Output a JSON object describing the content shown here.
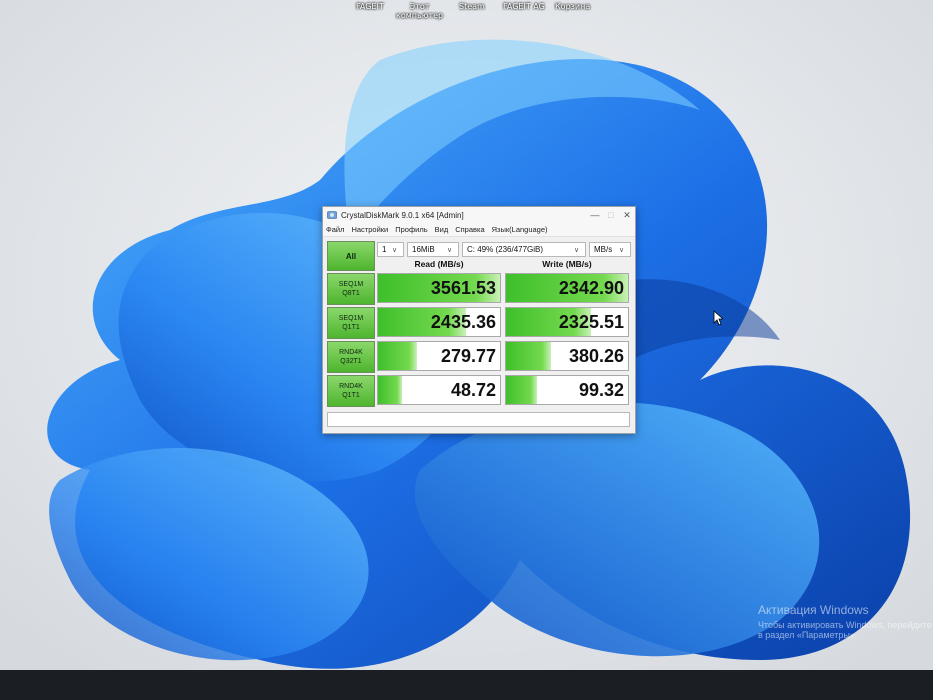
{
  "desktop": {
    "icons": [
      {
        "label": "FAGEIT"
      },
      {
        "label": "Этот\nкомпьютер"
      },
      {
        "label": "Steam"
      },
      {
        "label": "FAGEIT AG"
      },
      {
        "label": "Корзина"
      }
    ],
    "activation": {
      "title": "Активация Windows",
      "subtitle": "Чтобы активировать Windows, перейдите в раздел «Параметры»."
    }
  },
  "window": {
    "title": "CrystalDiskMark 9.0.1 x64 [Admin]",
    "menu": [
      "Файл",
      "Настройки",
      "Профиль",
      "Вид",
      "Справка",
      "Язык(Language)"
    ],
    "all_button": "All",
    "count": "1",
    "size": "16MiB",
    "drive": "C: 49% (236/477GiB)",
    "unit": "MB/s",
    "headers": {
      "read": "Read (MB/s)",
      "write": "Write (MB/s)"
    },
    "rows": [
      {
        "line1": "SEQ1M",
        "line2": "Q8T1",
        "read": "3561.53",
        "write": "2342.90",
        "read_fill": 1.0,
        "write_fill": 1.0
      },
      {
        "line1": "SEQ1M",
        "line2": "Q1T1",
        "read": "2435.36",
        "write": "2325.51",
        "read_fill": 0.72,
        "write_fill": 0.7
      },
      {
        "line1": "RND4K",
        "line2": "Q32T1",
        "read": "279.77",
        "write": "380.26",
        "read_fill": 0.32,
        "write_fill": 0.37
      },
      {
        "line1": "RND4K",
        "line2": "Q1T1",
        "read": "48.72",
        "write": "99.32",
        "read_fill": 0.2,
        "write_fill": 0.25
      }
    ]
  }
}
